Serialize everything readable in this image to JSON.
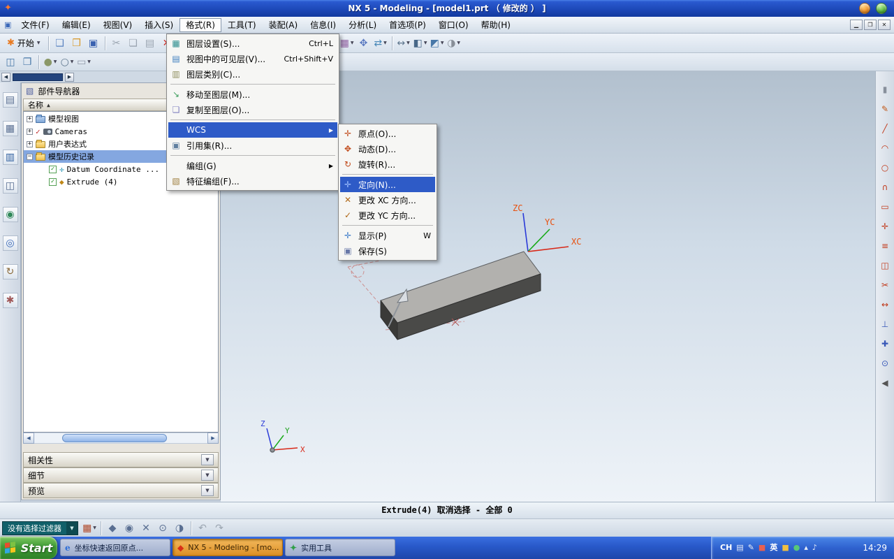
{
  "titlebar": {
    "title": "NX 5 - Modeling - [model1.prt （ 修改的 ） ]"
  },
  "menubar": {
    "items": [
      "文件(F)",
      "编辑(E)",
      "视图(V)",
      "插入(S)",
      "格式(R)",
      "工具(T)",
      "装配(A)",
      "信息(I)",
      "分析(L)",
      "首选项(P)",
      "窗口(O)",
      "帮助(H)"
    ],
    "open_index": 4
  },
  "toolbar": {
    "start_label": "开始",
    "icons": [
      {
        "sep": true
      },
      {
        "n": "new-part-icon",
        "g": "❑",
        "c": "#5a82c0"
      },
      {
        "n": "open-icon",
        "g": "❒",
        "c": "#d89828"
      },
      {
        "n": "save-icon",
        "g": "▣",
        "c": "#3a62b0"
      },
      {
        "sep": true
      },
      {
        "n": "cut-icon",
        "g": "✂",
        "c": "#9aa4b0"
      },
      {
        "n": "copy-icon",
        "g": "❏",
        "c": "#9aa4b0"
      },
      {
        "n": "paste-icon",
        "g": "▤",
        "c": "#9aa4b0"
      },
      {
        "n": "delete-icon",
        "g": "✕",
        "c": "#d03028"
      },
      {
        "sep": true
      },
      {
        "n": "sketch-icon",
        "g": "✎",
        "c": "#b87020"
      },
      {
        "n": "datum-plane-icon",
        "g": "◇",
        "c": "#2f9fc0",
        "dd": true
      },
      {
        "n": "extrude-icon",
        "g": "◆",
        "c": "#c89020",
        "dd": true
      },
      {
        "n": "hole-icon",
        "g": "◉",
        "c": "#60788f"
      },
      {
        "n": "unite-icon",
        "g": "◈",
        "c": "#b06828",
        "dd": true
      },
      {
        "n": "edge-blend-icon",
        "g": "◠",
        "c": "#b07030",
        "dd": true
      },
      {
        "n": "chamfer-icon",
        "g": "◢",
        "c": "#8f98a8"
      },
      {
        "n": "trim-body-icon",
        "g": "◪",
        "c": "#6088b0"
      },
      {
        "n": "shell-icon",
        "g": "▢",
        "c": "#70a060"
      },
      {
        "sep": true
      },
      {
        "n": "pattern-feature-icon",
        "g": "▦",
        "c": "#9060a0",
        "dd": true
      },
      {
        "n": "move-object-icon",
        "g": "✥",
        "c": "#5878c0"
      },
      {
        "n": "synchronous-modeling-icon",
        "g": "⇄",
        "c": "#4888b8",
        "dd": true
      },
      {
        "sep": true
      },
      {
        "n": "measure-icon",
        "g": "↔",
        "c": "#60788f",
        "dd": true
      },
      {
        "n": "section-view-icon",
        "g": "◧",
        "c": "#486888",
        "dd": true
      },
      {
        "n": "orient-view-icon",
        "g": "◩",
        "c": "#4878a8",
        "dd": true
      },
      {
        "n": "render-style-icon",
        "g": "◑",
        "c": "#888f98",
        "dd": true
      }
    ]
  },
  "toolbar2": {
    "icons": [
      {
        "n": "maximize-layout-icon",
        "g": "◫",
        "c": "#4878a8"
      },
      {
        "n": "cascade-layout-icon",
        "g": "❐",
        "c": "#4878a8"
      },
      {
        "sep": true
      },
      {
        "n": "shaded-mode-icon",
        "g": "●",
        "c": "#8a9868",
        "dd": true
      },
      {
        "n": "wireframe-mode-icon",
        "g": "○",
        "c": "#60788f",
        "dd": true
      },
      {
        "n": "snap-view-icon",
        "g": "▭",
        "c": "#8f98a8",
        "dd": true
      }
    ]
  },
  "resource_bar": {
    "icons": [
      {
        "n": "assembly-navigator-tab",
        "g": "▤",
        "c": "#5a6f92"
      },
      {
        "n": "constraint-navigator-tab",
        "g": "▦",
        "c": "#5a6f92"
      },
      {
        "n": "part-navigator-tab",
        "g": "▥",
        "c": "#2f5f9f"
      },
      {
        "n": "reuse-library-tab",
        "g": "◫",
        "c": "#5a6f92"
      },
      {
        "n": "hd3d-tools-tab",
        "g": "◉",
        "c": "#2f8858"
      },
      {
        "n": "web-browser-tab",
        "g": "◎",
        "c": "#3868b8"
      },
      {
        "n": "history-palette-tab",
        "g": "↻",
        "c": "#8a6a3a"
      },
      {
        "n": "roles-palette-tab",
        "g": "✱",
        "c": "#a05858"
      }
    ]
  },
  "right_toolbar": {
    "icons": [
      {
        "n": "fit-view-icon",
        "g": "▮",
        "c": "#88909c"
      },
      {
        "n": "sketch-pencil-icon",
        "g": "✎",
        "c": "#c05818"
      },
      {
        "n": "line-tool-icon",
        "g": "╱",
        "c": "#c03818"
      },
      {
        "n": "arc-tool-icon",
        "g": "◠",
        "c": "#c03818"
      },
      {
        "n": "circle-tool-icon",
        "g": "○",
        "c": "#c03818"
      },
      {
        "n": "fillet-tool-icon",
        "g": "∩",
        "c": "#c03818"
      },
      {
        "n": "rectangle-tool-icon",
        "g": "▭",
        "c": "#c03818"
      },
      {
        "n": "point-tool-icon",
        "g": "✛",
        "c": "#c03818"
      },
      {
        "n": "offset-tool-icon",
        "g": "≡",
        "c": "#c03818"
      },
      {
        "n": "mirror-tool-icon",
        "g": "◫",
        "c": "#c03818"
      },
      {
        "n": "quick-trim-icon",
        "g": "✂",
        "c": "#c03818"
      },
      {
        "n": "extend-tool-icon",
        "g": "↔",
        "c": "#c03818"
      },
      {
        "n": "constraints-icon",
        "g": "⊥",
        "c": "#3858b8"
      },
      {
        "n": "dimension-icon",
        "g": "✚",
        "c": "#3858b8"
      },
      {
        "n": "show-constraints-icon",
        "g": "⊙",
        "c": "#3858b8"
      },
      {
        "n": "collapse-panel-icon",
        "g": "◀",
        "c": "#555555"
      }
    ]
  },
  "format_menu": {
    "items": [
      {
        "n": "menu-item-layer-settings",
        "label": "图层设置(S)...",
        "accel": "Ctrl+L",
        "g": "▦",
        "c": "#2f8f8f"
      },
      {
        "n": "menu-item-visible-in-view",
        "label": "视图中的可见层(V)...",
        "accel": "Ctrl+Shift+V",
        "g": "▤",
        "c": "#3f7fbf"
      },
      {
        "n": "menu-item-layer-category",
        "label": "图层类别(C)...",
        "g": "▥",
        "c": "#8f8f5f"
      },
      {
        "sep": true
      },
      {
        "n": "menu-item-move-to-layer",
        "label": "移动至图层(M)...",
        "g": "↘",
        "c": "#3f9f5f"
      },
      {
        "n": "menu-item-copy-to-layer",
        "label": "复制至图层(O)...",
        "g": "❏",
        "c": "#7f7fbf"
      },
      {
        "sep": true
      },
      {
        "n": "menu-item-wcs",
        "label": "WCS",
        "hl": true,
        "sub": true
      },
      {
        "n": "menu-item-reference-sets",
        "label": "引用集(R)...",
        "g": "▣",
        "c": "#5f7f9f"
      },
      {
        "sep": true
      },
      {
        "n": "menu-item-group",
        "label": "编组(G)",
        "sub": true
      },
      {
        "n": "menu-item-feature-group",
        "label": "特征编组(F)...",
        "g": "▧",
        "c": "#9f7f3f"
      }
    ]
  },
  "wcs_submenu": {
    "items": [
      {
        "n": "submenu-item-origin",
        "label": "原点(O)...",
        "g": "✛",
        "c": "#c04818"
      },
      {
        "n": "submenu-item-dynamics",
        "label": "动态(D)...",
        "g": "✥",
        "c": "#c04818"
      },
      {
        "n": "submenu-item-rotate",
        "label": "旋转(R)...",
        "g": "↻",
        "c": "#c04818"
      },
      {
        "sep": true
      },
      {
        "n": "submenu-item-orient",
        "label": "定向(N)...",
        "hl": true,
        "g": "✛",
        "c": "#9fc0ff"
      },
      {
        "n": "submenu-item-change-xc",
        "label": "更改 XC 方向...",
        "g": "✕",
        "c": "#b06818"
      },
      {
        "n": "submenu-item-change-yc",
        "label": "更改 YC 方向...",
        "g": "✓",
        "c": "#b06818"
      },
      {
        "sep": true
      },
      {
        "n": "submenu-item-display",
        "label": "显示(P)",
        "accel": "W",
        "g": "✛",
        "c": "#3878c8"
      },
      {
        "n": "submenu-item-save",
        "label": "保存(S)",
        "g": "▣",
        "c": "#6878a8"
      }
    ]
  },
  "navigator": {
    "title": "部件导航器",
    "column_header": "名称",
    "tree": [
      {
        "n": "tree-item-model-views",
        "label": "模型视图",
        "exp": "+",
        "icon": "folder-blue"
      },
      {
        "n": "tree-item-cameras",
        "label": "Cameras",
        "exp": "+",
        "check": "red",
        "icon": "camera"
      },
      {
        "n": "tree-item-user-expressions",
        "label": "用户表达式",
        "exp": "+",
        "icon": "folder"
      },
      {
        "n": "tree-item-model-history",
        "label": "模型历史记录",
        "exp": "-",
        "icon": "folder",
        "selected": true
      },
      {
        "n": "tree-item-datum-csys",
        "label": "Datum Coordinate ...",
        "indent": 1,
        "check": "green",
        "icon": "datum"
      },
      {
        "n": "tree-item-extrude",
        "label": "Extrude (4)",
        "indent": 1,
        "check": "green",
        "icon": "extrude"
      }
    ],
    "sections": [
      {
        "n": "section-dependencies",
        "label": "相关性"
      },
      {
        "n": "section-details",
        "label": "细节"
      },
      {
        "n": "section-preview",
        "label": "预览"
      }
    ]
  },
  "viewport": {
    "wcs": {
      "z": "ZC",
      "y": "YC",
      "x": "XC"
    },
    "triad": {
      "z": "Z",
      "y": "Y",
      "x": "X"
    }
  },
  "cue_bar": {
    "text": "Extrude(4) 取消选择 - 全部 0"
  },
  "selection_bar": {
    "filter_value": "没有选择过滤器",
    "icons": [
      {
        "n": "snap-point-grid-icon",
        "g": "▦",
        "c": "#b04828",
        "dd": true
      },
      {
        "sep": true
      },
      {
        "n": "end-point-snap-icon",
        "g": "◆",
        "c": "#5a6f92"
      },
      {
        "n": "mid-point-snap-icon",
        "g": "◉",
        "c": "#5a6f92"
      },
      {
        "n": "intersection-snap-icon",
        "g": "✕",
        "c": "#5a6f92"
      },
      {
        "n": "arc-center-snap-icon",
        "g": "⊙",
        "c": "#5a6f92"
      },
      {
        "n": "quadrant-snap-icon",
        "g": "◑",
        "c": "#5a6f92"
      },
      {
        "sep": true
      },
      {
        "n": "previous-selection-icon",
        "g": "↶",
        "c": "#9aa4b0"
      },
      {
        "n": "next-selection-icon",
        "g": "↷",
        "c": "#9aa4b0"
      }
    ]
  },
  "taskbar": {
    "start_label": "Start",
    "time": "14:29",
    "tasks": [
      {
        "n": "taskbar-task-coordinate",
        "label": "坐标快速返回原点...",
        "icon": "e",
        "icon_color": "#2f6fd8",
        "active": false
      },
      {
        "n": "taskbar-task-nx",
        "label": "NX 5 - Modeling - [mo...",
        "icon": "◆",
        "icon_color": "#d83018",
        "active": true
      },
      {
        "n": "taskbar-task-utility",
        "label": "实用工具",
        "icon": "✦",
        "icon_color": "#2f9f48",
        "active": false
      }
    ],
    "tray": [
      {
        "n": "language-indicator",
        "t": "CH"
      },
      {
        "n": "keyboard-tray-icon",
        "g": "▤",
        "c": "#e8eef8"
      },
      {
        "n": "ime-pen-tray-icon",
        "g": "✎",
        "c": "#e8eef8"
      },
      {
        "n": "ime-mode-tray-icon",
        "g": "■",
        "c": "#e86050"
      },
      {
        "n": "ime-eng-indicator",
        "t": "英"
      },
      {
        "n": "ime-punct-tray-icon",
        "g": "■",
        "c": "#f0c040"
      },
      {
        "n": "app-tray-icon",
        "g": "●",
        "c": "#58c878"
      },
      {
        "n": "show-hidden-tray-icon",
        "g": "▴",
        "c": "#e8eef8"
      },
      {
        "n": "volume-tray-icon",
        "g": "♪",
        "c": "#e8eef8"
      }
    ]
  },
  "colors": {
    "titlebar_blue": "#1c47b6",
    "menu_highlight": "#2e5bc7",
    "taskbar_blue": "#2858c8",
    "start_green": "#3f9a36",
    "active_task_orange": "#dd8f24",
    "axis_label_orange": "#e8500e",
    "selection_filter_teal": "#11606a"
  }
}
